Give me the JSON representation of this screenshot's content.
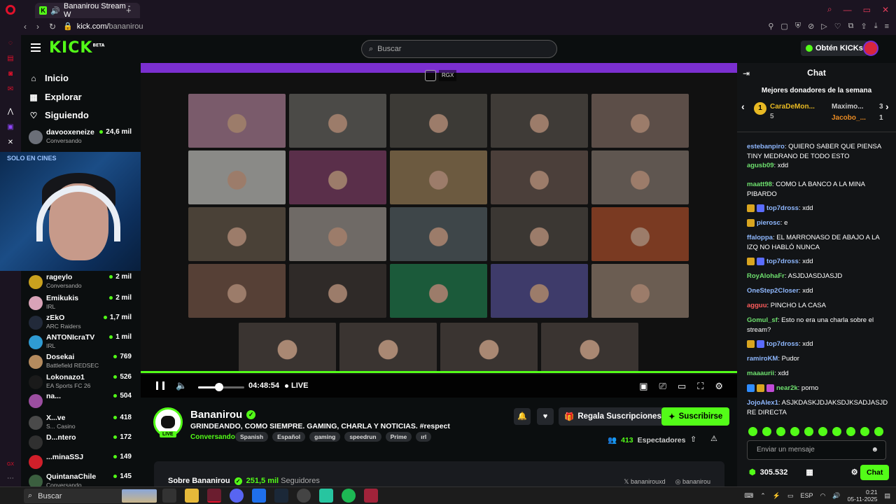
{
  "browser": {
    "tab_title": "Bananirou Stream - W",
    "url_host": "kick.com/",
    "url_path": "bananirou"
  },
  "header": {
    "logo_text": "KICK",
    "logo_badge": "BETA",
    "search_placeholder": "Buscar",
    "kicks_button": "Obtén KICKs"
  },
  "sidebar": {
    "nav": [
      {
        "label": "Inicio",
        "icon": "home-icon"
      },
      {
        "label": "Explorar",
        "icon": "compass-icon"
      },
      {
        "label": "Siguiendo",
        "icon": "heart-icon"
      }
    ],
    "channels": [
      {
        "name": "davooxeneize",
        "category": "Conversando",
        "viewers": "24,6 mil",
        "color": "#6b6f78"
      },
      {
        "name": "rageylo",
        "category": "Conversando",
        "viewers": "2 mil",
        "color": "#c9a11e"
      },
      {
        "name": "Emikukis",
        "category": "IRL",
        "viewers": "2 mil",
        "color": "#d9a3b8"
      },
      {
        "name": "zEkO",
        "category": "ARC Raiders",
        "viewers": "1,7 mil",
        "color": "#222a3a"
      },
      {
        "name": "ANTONIcraTV",
        "category": "IRL",
        "viewers": "1 mil",
        "color": "#2f9bd3"
      },
      {
        "name": "Dosekai",
        "category": "Battlefield REDSEC",
        "viewers": "769",
        "color": "#b58b5e"
      },
      {
        "name": "Lokonazo1",
        "category": "EA Sports FC 26",
        "viewers": "526",
        "color": "#1a1a1a"
      },
      {
        "name": "na...",
        "category": "",
        "viewers": "504",
        "color": "#9b4ea0"
      },
      {
        "name": "X...ve",
        "category": "S... Casino",
        "viewers": "418",
        "color": "#4a4a4a"
      },
      {
        "name": "D...ntero",
        "category": "",
        "viewers": "172",
        "color": "#303030"
      },
      {
        "name": "...minaSSJ",
        "category": "",
        "viewers": "149",
        "color": "#d11f2a"
      },
      {
        "name": "QuintanaChile",
        "category": "Conversando",
        "viewers": "145",
        "color": "#3b5f3f"
      }
    ],
    "webcam_sign": "SOLO EN CINES"
  },
  "player": {
    "time": "04:48:54",
    "live_label": "LIVE",
    "rgx_label": "RGX",
    "volume_percent": 45
  },
  "channel": {
    "name": "Bananirou",
    "live_badge": "LIVE",
    "title": "GRINDEANDO, COMO SIEMPRE. GAMING, CHARLA Y NOTICIAS. #respect",
    "category": "Conversando",
    "tags": [
      "Spanish",
      "Español",
      "gaming",
      "speedrun",
      "Prime",
      "ırl"
    ],
    "gift_button": "Regala Suscripciones",
    "subscribe_button": "Suscribirse",
    "viewers_count": "413",
    "viewers_label": "Espectadores",
    "about_title": "Sobre Bananirou",
    "followers_count": "251,5 mil",
    "followers_label": "Seguidores",
    "social_x": "bananirouxd",
    "social_ig": "bananirou"
  },
  "chat": {
    "title": "Chat",
    "top_donors_title": "Mejores donadores de la semana",
    "donors": [
      {
        "rank": "1",
        "name": "CaraDeMon...",
        "count": "5"
      },
      {
        "rank": "",
        "name": "Maximo...",
        "count": "3"
      },
      {
        "rank": "",
        "name": "Jacobo_...",
        "count": "1"
      }
    ],
    "messages": [
      {
        "user": "estebanpiro",
        "color": "#8fb8ff",
        "text": "QUIERO SABER QUE PIENSA TINY MEDRANO DE TODO ESTO",
        "badges": []
      },
      {
        "user": "agusb09",
        "color": "#6ee06e",
        "text": "xdd",
        "badges": []
      },
      {
        "user": "maatt98",
        "color": "#6ee06e",
        "text": "COMO LA BANCO A LA MINA PIBARDO",
        "badges": []
      },
      {
        "user": "top7dross",
        "color": "#8fb8ff",
        "text": "xdd",
        "badges": [
          "#d9a520",
          "#5a6cff"
        ]
      },
      {
        "user": "pierosc",
        "color": "#8fb8ff",
        "text": "e",
        "badges": [
          "#d9a520"
        ]
      },
      {
        "user": "ffaloppa",
        "color": "#8fb8ff",
        "text": "EL MARRONASO DE ABAJO A LA IZQ NO HABLÓ NUNCA",
        "badges": []
      },
      {
        "user": "top7dross",
        "color": "#8fb8ff",
        "text": "xdd",
        "badges": [
          "#d9a520",
          "#5a6cff"
        ]
      },
      {
        "user": "RoyAlohaFr",
        "color": "#6ee06e",
        "text": "ASJDJASDJASJD",
        "badges": []
      },
      {
        "user": "OneStep2Closer",
        "color": "#8fb8ff",
        "text": "xdd",
        "badges": []
      },
      {
        "user": "agguu",
        "color": "#ff5c5c",
        "text": "PINCHO LA CASA",
        "badges": []
      },
      {
        "user": "Gomul_sf",
        "color": "#6ee06e",
        "text": "Esto no era una charla sobre el stream?",
        "badges": []
      },
      {
        "user": "top7dross",
        "color": "#8fb8ff",
        "text": "xdd",
        "badges": [
          "#d9a520",
          "#5a6cff"
        ]
      },
      {
        "user": "ramiroKM",
        "color": "#8fb8ff",
        "text": "Pudor",
        "badges": []
      },
      {
        "user": "maaaurii",
        "color": "#6ee06e",
        "text": "xdd",
        "badges": []
      },
      {
        "user": "near2k",
        "color": "#6ee06e",
        "text": "porno",
        "badges": [
          "#2f8cff",
          "#d9a520",
          "#c04bd6"
        ]
      },
      {
        "user": "JojoAlex1",
        "color": "#8fb8ff",
        "text": "ASJKDASKJDJAKSDJKSADJASJD RE DIRECTA",
        "badges": []
      }
    ],
    "input_placeholder": "Enviar un mensaje",
    "kicks_balance": "305.532",
    "chat_button": "Chat"
  },
  "taskbar": {
    "search_label": "Buscar",
    "lang": "ESP",
    "time": "0:21",
    "date": "05-11-2025"
  },
  "colors": {
    "accent": "#53fc18",
    "background": "#0b0e0f",
    "purple_bar": "#7b2fd0"
  }
}
